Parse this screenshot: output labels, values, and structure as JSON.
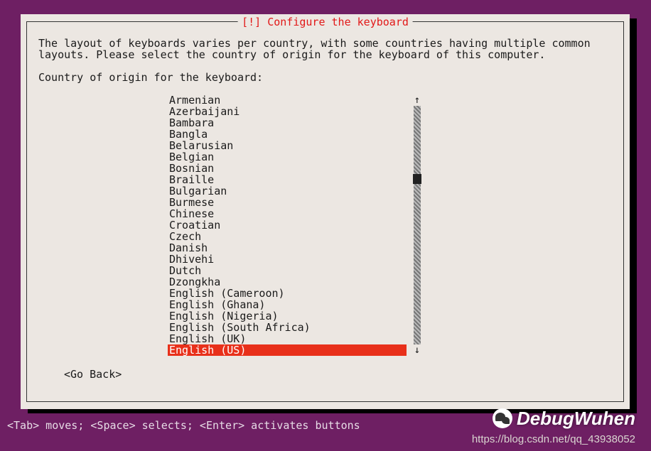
{
  "dialog": {
    "title": "[!] Configure the keyboard",
    "description": "The layout of keyboards varies per country, with some countries having multiple common layouts. Please select the country of origin for the keyboard of this computer.",
    "prompt": "Country of origin for the keyboard:",
    "go_back": "<Go Back>"
  },
  "list": {
    "items": [
      "Armenian",
      "Azerbaijani",
      "Bambara",
      "Bangla",
      "Belarusian",
      "Belgian",
      "Bosnian",
      "Braille",
      "Bulgarian",
      "Burmese",
      "Chinese",
      "Croatian",
      "Czech",
      "Danish",
      "Dhivehi",
      "Dutch",
      "Dzongkha",
      "English (Cameroon)",
      "English (Ghana)",
      "English (Nigeria)",
      "English (South Africa)",
      "English (UK)",
      "English (US)"
    ],
    "selected_index": 22,
    "scroll_up_glyph": "↑",
    "scroll_down_glyph": "↓"
  },
  "helpbar": "<Tab> moves; <Space> selects; <Enter> activates buttons",
  "watermark": {
    "name": "DebugWuhen",
    "url": "https://blog.csdn.net/qq_43938052"
  }
}
